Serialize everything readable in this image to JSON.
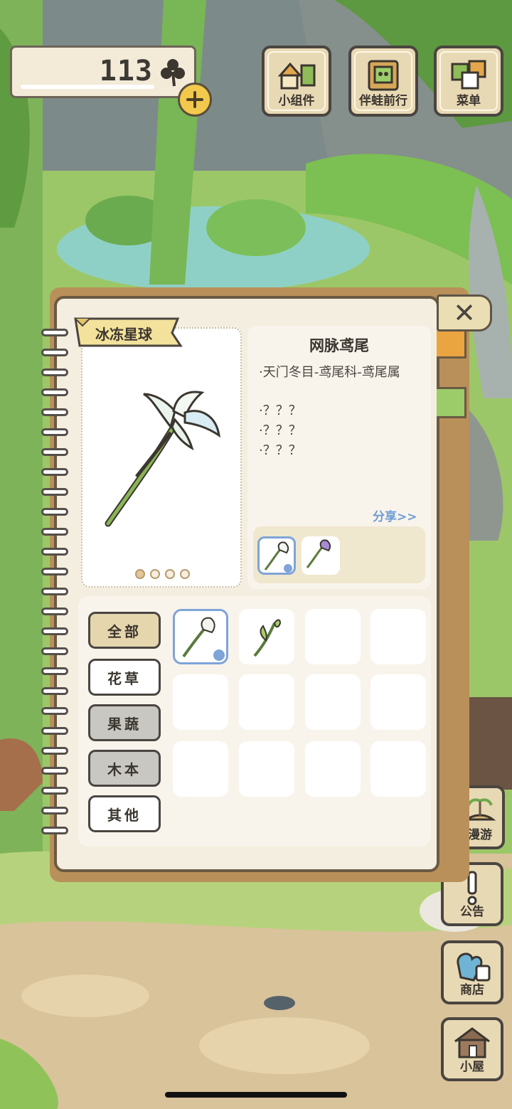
{
  "hud": {
    "clover_count": "113",
    "top_buttons": [
      {
        "label": "小组件",
        "icon": "widget-icon"
      },
      {
        "label": "伴蛙前行",
        "icon": "album-icon"
      },
      {
        "label": "菜单",
        "icon": "menu-icon"
      }
    ]
  },
  "side_buttons": [
    {
      "label": "漫游",
      "icon": "island-icon"
    },
    {
      "label": "公告",
      "icon": "exclamation-icon"
    },
    {
      "label": "商店",
      "icon": "shop-bag-icon"
    },
    {
      "label": "小屋",
      "icon": "house-icon"
    }
  ],
  "book": {
    "plant_tag": "冰冻星球",
    "plant_name": "网脉鸢尾",
    "info_lines": [
      "·天门冬目-鸢尾科-鸢尾属",
      "·？？？",
      "·？？？",
      "·？？？"
    ],
    "share_label": "分享>>",
    "page_dots": 4,
    "active_dot": 0,
    "categories": [
      {
        "label": "全部",
        "state": "active"
      },
      {
        "label": "花草",
        "state": "normal"
      },
      {
        "label": "果蔬",
        "state": "locked"
      },
      {
        "label": "木本",
        "state": "locked"
      },
      {
        "label": "其他",
        "state": "normal"
      }
    ],
    "close_label": "✕"
  },
  "colors": {
    "paper": "#f4eee0",
    "border": "#6a5a43",
    "selected": "#7ea4d8",
    "share": "#6f9dd6"
  }
}
